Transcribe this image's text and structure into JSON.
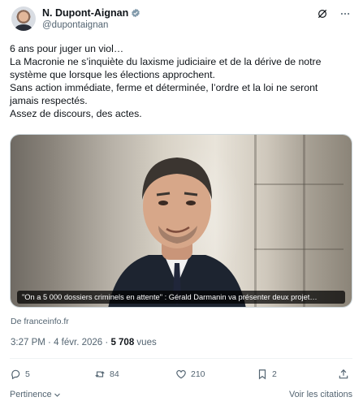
{
  "author": {
    "name": "N. Dupont-Aignan",
    "handle": "@dupontaignan"
  },
  "tweet": {
    "lines": [
      "6 ans pour juger un viol…",
      "La Macronie ne s’inquiète du laxisme judiciaire et de la dérive de notre",
      "système que lorsque les élections approchent.",
      "Sans action immédiate, ferme et déterminée, l’ordre et la loi ne seront",
      "jamais respectés.",
      "Assez de discours, des actes."
    ]
  },
  "card": {
    "caption": "\"On a 5 000 dossiers criminels en attente\" : Gérald Darmanin va présenter deux projet…",
    "source": "De franceinfo.fr"
  },
  "meta": {
    "time": "3:27 PM",
    "separator1": "·",
    "date": "4 févr. 2026",
    "separator2": "·",
    "views_count": "5 708",
    "views_label": "vues"
  },
  "actions": {
    "replies": "5",
    "reposts": "84",
    "likes": "210",
    "bookmarks": "2"
  },
  "footer": {
    "sort_label": "Pertinence",
    "citations_label": "Voir les citations"
  },
  "colors": {
    "text": "#0f1419",
    "secondary": "#536471",
    "verified": "#829aab",
    "border": "#cfd9de"
  }
}
